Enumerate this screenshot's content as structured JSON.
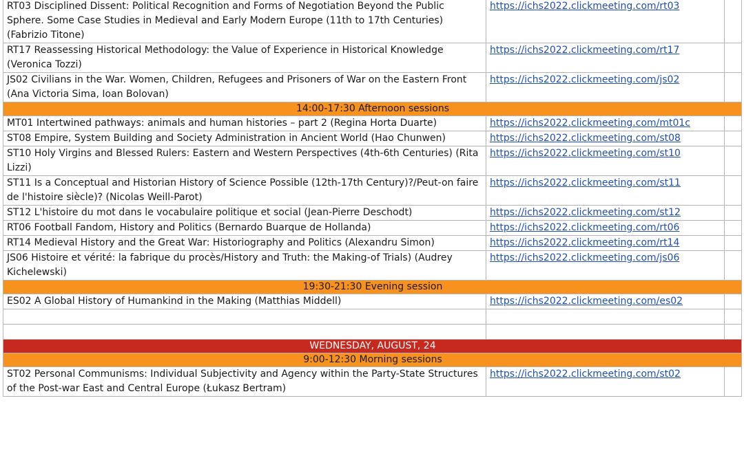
{
  "rows_top": [
    {
      "title": "RT03 Disciplined Dissent: Political Recognition and Forms of Negotiation Beyond the Public Sphere. Some Case Studies in Medieval and Early Modern Europe (11th to 17th Centuries) (Fabrizio Titone)",
      "link": "https://ichs2022.clickmeeting.com/rt03"
    },
    {
      "title": "RT17 Reassessing Historical Methodology: the Value of Experience in Historical Knowledge (Veronica Tozzi)",
      "link": "https://ichs2022.clickmeeting.com/rt17"
    },
    {
      "title": "JS02 Civilians in the War. Women, Children, Refugees and Prisoners of War on the Eastern Front (Ana Victoria Sima, Ioan Bolovan)",
      "link": "https://ichs2022.clickmeeting.com/js02"
    }
  ],
  "afternoon_header": "14:00-17:30 Afternoon sessions",
  "rows_afternoon": [
    {
      "title": "MT01 Intertwined pathways: animals and human histories – part 2 (Regina Horta Duarte)",
      "link": "https://ichs2022.clickmeeting.com/mt01c"
    },
    {
      "title": "ST08 Empire, System Building and Society Administration in Ancient World (Hao Chunwen)",
      "link": "https://ichs2022.clickmeeting.com/st08"
    },
    {
      "title": "ST10 Holy Virgins and Blessed Rulers: Eastern and Western Perspectives (4th-6th Centuries) (Rita Lizzi)",
      "link": "https://ichs2022.clickmeeting.com/st10"
    },
    {
      "title": "ST11 Is a Conceptual and Historian History of Science Possible (12th-17th Century)?/Peut-on faire de l'histoire siècle)? (Nicolas Weill-Parot)",
      "link": "https://ichs2022.clickmeeting.com/st11"
    },
    {
      "title": "ST12 L'histoire du mot dans le vocabulaire politique et social (Jean-Pierre Deschodt)",
      "link": "https://ichs2022.clickmeeting.com/st12"
    },
    {
      "title": "RT06 Football Fandom, History and Politics (Bernardo Buarque de Hollanda)",
      "link": "https://ichs2022.clickmeeting.com/rt06"
    },
    {
      "title": "RT14 Medieval History and the Great War: Historiography and Politics (Alexandru Simon)",
      "link": "https://ichs2022.clickmeeting.com/rt14"
    },
    {
      "title": "JS06 Histoire et vérité: la fabrique du procès/History and Truth: the Making-of Trials) (Audrey Kichelewski)",
      "link": "https://ichs2022.clickmeeting.com/js06"
    }
  ],
  "evening_header": "19:30-21:30 Evening session",
  "rows_evening": [
    {
      "title": "ES02 A Global History of Humankind in the Making (Matthias Middell)",
      "link": "https://ichs2022.clickmeeting.com/es02"
    }
  ],
  "day_header": "WEDNESDAY, AUGUST, 24",
  "morning_header": "9:00-12:30 Morning sessions",
  "rows_morning": [
    {
      "title": "ST02 Personal Communisms: Individual Subjectivity and Agency within the Party-State Structures of the Post-war East and Central Europe (Łukasz Bertram)",
      "link": "https://ichs2022.clickmeeting.com/st02"
    }
  ],
  "colors": {
    "session_header": "#f7921e",
    "day_header": "#c8291f",
    "link": "#1f4fb0"
  }
}
